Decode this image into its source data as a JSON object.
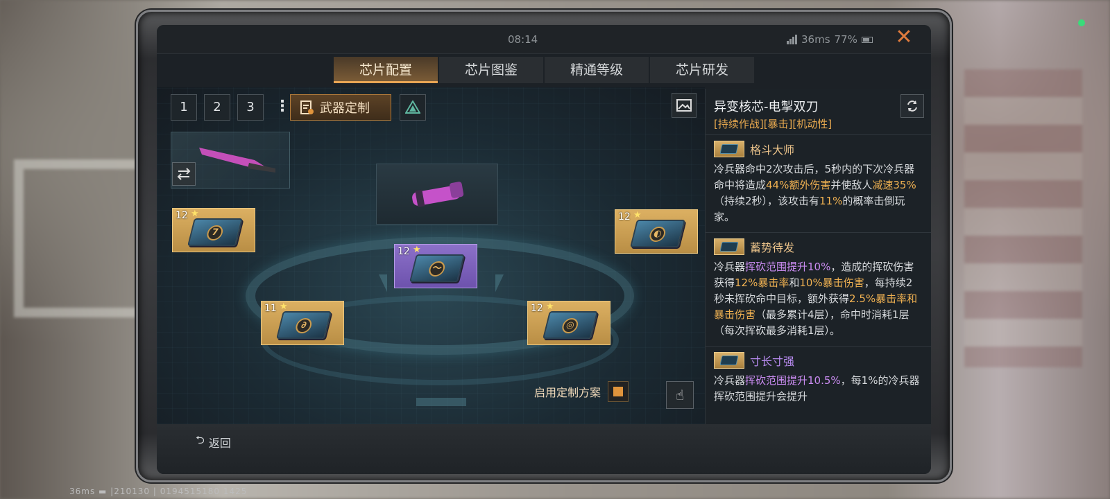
{
  "hud": {
    "bottom_status": "36ms ▬ |210130 | 0194515180 1425"
  },
  "window": {
    "time": "08:14",
    "ping": "36ms",
    "battery": "77%",
    "close_label": "✕"
  },
  "tabs": [
    {
      "label": "芯片配置",
      "active": true
    },
    {
      "label": "芯片图鉴",
      "active": false
    },
    {
      "label": "精通等级",
      "active": false
    },
    {
      "label": "芯片研发",
      "active": false
    }
  ],
  "toolbar": {
    "presets": [
      "1",
      "2",
      "3"
    ],
    "more_label": "⋮",
    "custom_label": "武器定制"
  },
  "chips": [
    {
      "level": "12",
      "glyph": "7",
      "color": "gold"
    },
    {
      "level": "12",
      "glyph": "◐",
      "color": "gold"
    },
    {
      "level": "12",
      "glyph": "〜",
      "color": "purple"
    },
    {
      "level": "11",
      "glyph": "∂",
      "color": "gold"
    },
    {
      "level": "12",
      "glyph": "◎",
      "color": "gold"
    }
  ],
  "enable": {
    "label": "启用定制方案",
    "checked": true
  },
  "back_label": "返回",
  "panel": {
    "title": "异变核芯-电掣双刀",
    "tags": "[持续作战][暴击][机动性]",
    "sections": [
      {
        "name": "格斗大师",
        "lines": [
          [
            "冷兵器命中2次攻击后，5秒内的下次冷兵器命中将造成",
            ""
          ],
          [
            "44%额外伤害",
            "y"
          ],
          [
            "并使敌人",
            ""
          ],
          [
            "减速35%",
            "y"
          ],
          [
            "（持续2秒），该攻击有",
            ""
          ],
          [
            "11%",
            "y"
          ],
          [
            "的概率击倒玩家。",
            ""
          ]
        ]
      },
      {
        "name": "蓄势待发",
        "lines": [
          [
            "冷兵器",
            ""
          ],
          [
            "挥砍范围提升10%",
            "p"
          ],
          [
            "，造成的挥砍伤害获得",
            ""
          ],
          [
            "12%暴击率",
            "y"
          ],
          [
            "和",
            ""
          ],
          [
            "10%暴击伤害",
            "y"
          ],
          [
            "，每持续2秒未挥砍命中目标，额外获得",
            ""
          ],
          [
            "2.5%暴击率和暴击伤害",
            "y"
          ],
          [
            "（最多累计4层），命中时消耗1层（每次挥砍最多消耗1层）。",
            ""
          ]
        ]
      },
      {
        "name": "寸长寸强",
        "lines": [
          [
            "冷兵器",
            ""
          ],
          [
            "挥砍范围提升10.5%",
            "p"
          ],
          [
            "，每1%的冷兵器挥砍范围提升会提升",
            ""
          ]
        ]
      }
    ]
  }
}
